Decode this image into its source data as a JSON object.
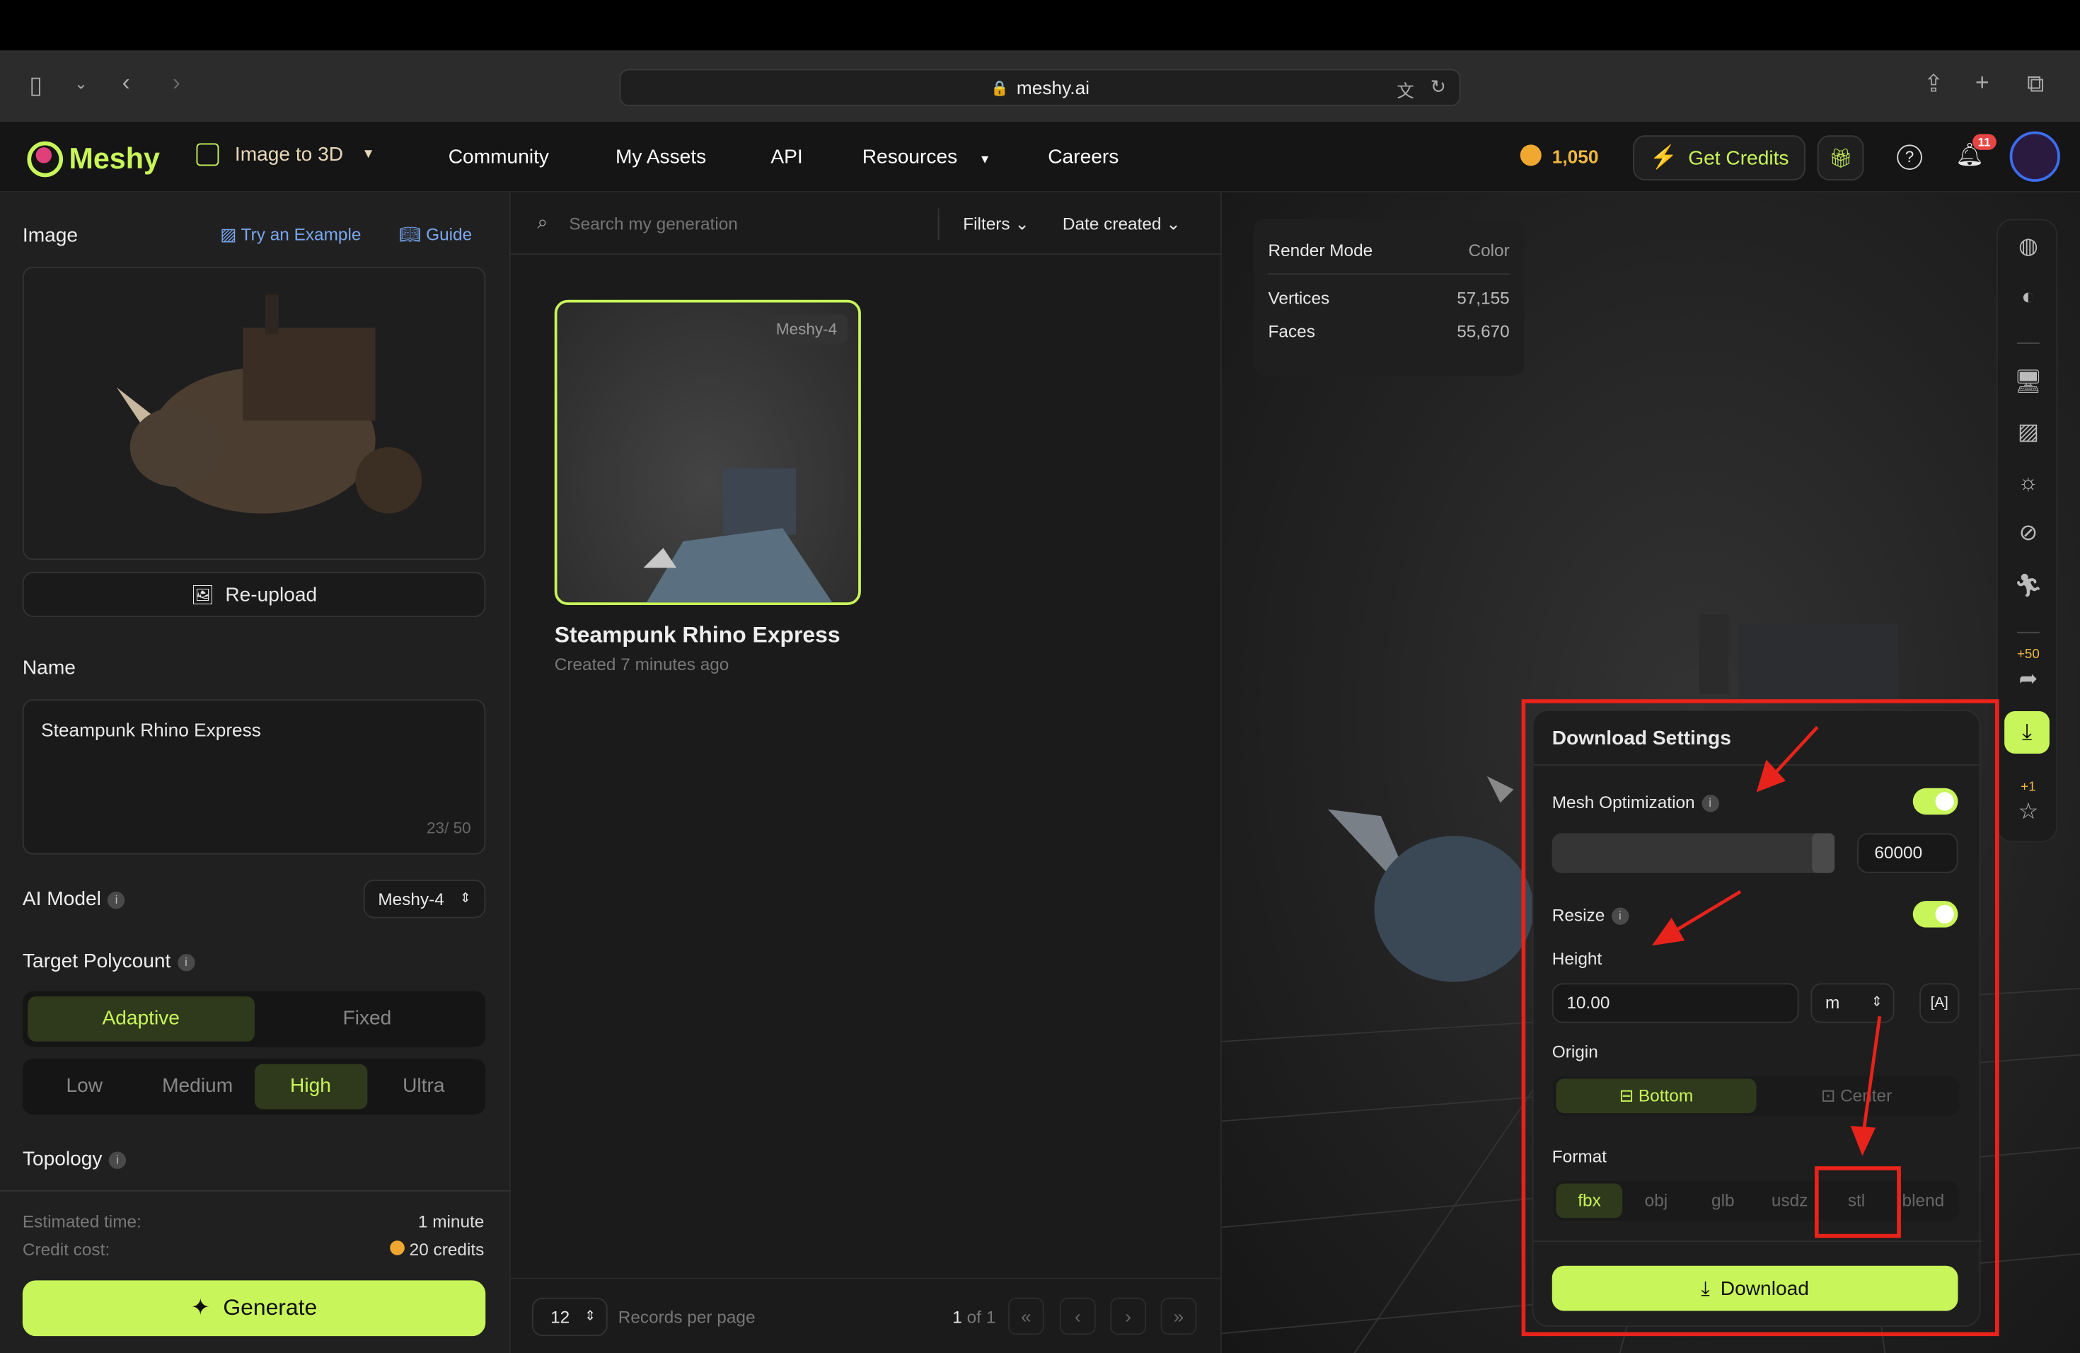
{
  "browser": {
    "url": "meshy.ai"
  },
  "nav": {
    "logo": "Meshy",
    "mode": "Image to 3D",
    "links": [
      "Community",
      "My Assets",
      "API",
      "Resources",
      "Careers"
    ],
    "credits": "1,050",
    "get_credits": "Get Credits",
    "notifications": "11"
  },
  "left": {
    "image_label": "Image",
    "try_example": "Try an Example",
    "guide": "Guide",
    "reupload": "Re-upload",
    "name_label": "Name",
    "name_value": "Steampunk Rhino Express",
    "name_count": "23/ 50",
    "ai_model_label": "AI Model",
    "ai_model_value": "Meshy-4",
    "polycount_label": "Target Polycount",
    "polycount_modes": [
      "Adaptive",
      "Fixed"
    ],
    "polycount_mode_selected": "Adaptive",
    "levels": [
      "Low",
      "Medium",
      "High",
      "Ultra"
    ],
    "level_selected": "High",
    "topology_label": "Topology",
    "est_time_label": "Estimated time:",
    "est_time_value": "1 minute",
    "credit_cost_label": "Credit cost:",
    "credit_cost_value": "20 credits",
    "generate": "Generate"
  },
  "mid": {
    "search_placeholder": "Search my generation",
    "filters": "Filters",
    "sort": "Date created",
    "card": {
      "badge": "Meshy-4",
      "title": "Steampunk Rhino Express",
      "subtitle": "Created 7 minutes ago"
    },
    "per_page": "12",
    "per_page_label": "Records per page",
    "page_current": "1",
    "page_of": "of 1"
  },
  "stats": {
    "render_mode_label": "Render Mode",
    "render_mode_value": "Color",
    "vertices_label": "Vertices",
    "vertices_value": "57,155",
    "faces_label": "Faces",
    "faces_value": "55,670"
  },
  "rail": {
    "share_bonus": "+50",
    "feedback_bonus": "+1"
  },
  "download": {
    "title": "Download Settings",
    "mesh_opt_label": "Mesh Optimization",
    "mesh_opt_on": true,
    "mesh_opt_value": "60000",
    "resize_label": "Resize",
    "resize_on": true,
    "height_label": "Height",
    "height_value": "10.00",
    "unit": "m",
    "origin_label": "Origin",
    "origins": [
      "Bottom",
      "Center"
    ],
    "origin_selected": "Bottom",
    "format_label": "Format",
    "formats": [
      "fbx",
      "obj",
      "glb",
      "usdz",
      "stl",
      "blend"
    ],
    "format_selected": "fbx",
    "button": "Download"
  },
  "colors": {
    "accent": "#c8f55a",
    "annotation": "#e8231b"
  }
}
